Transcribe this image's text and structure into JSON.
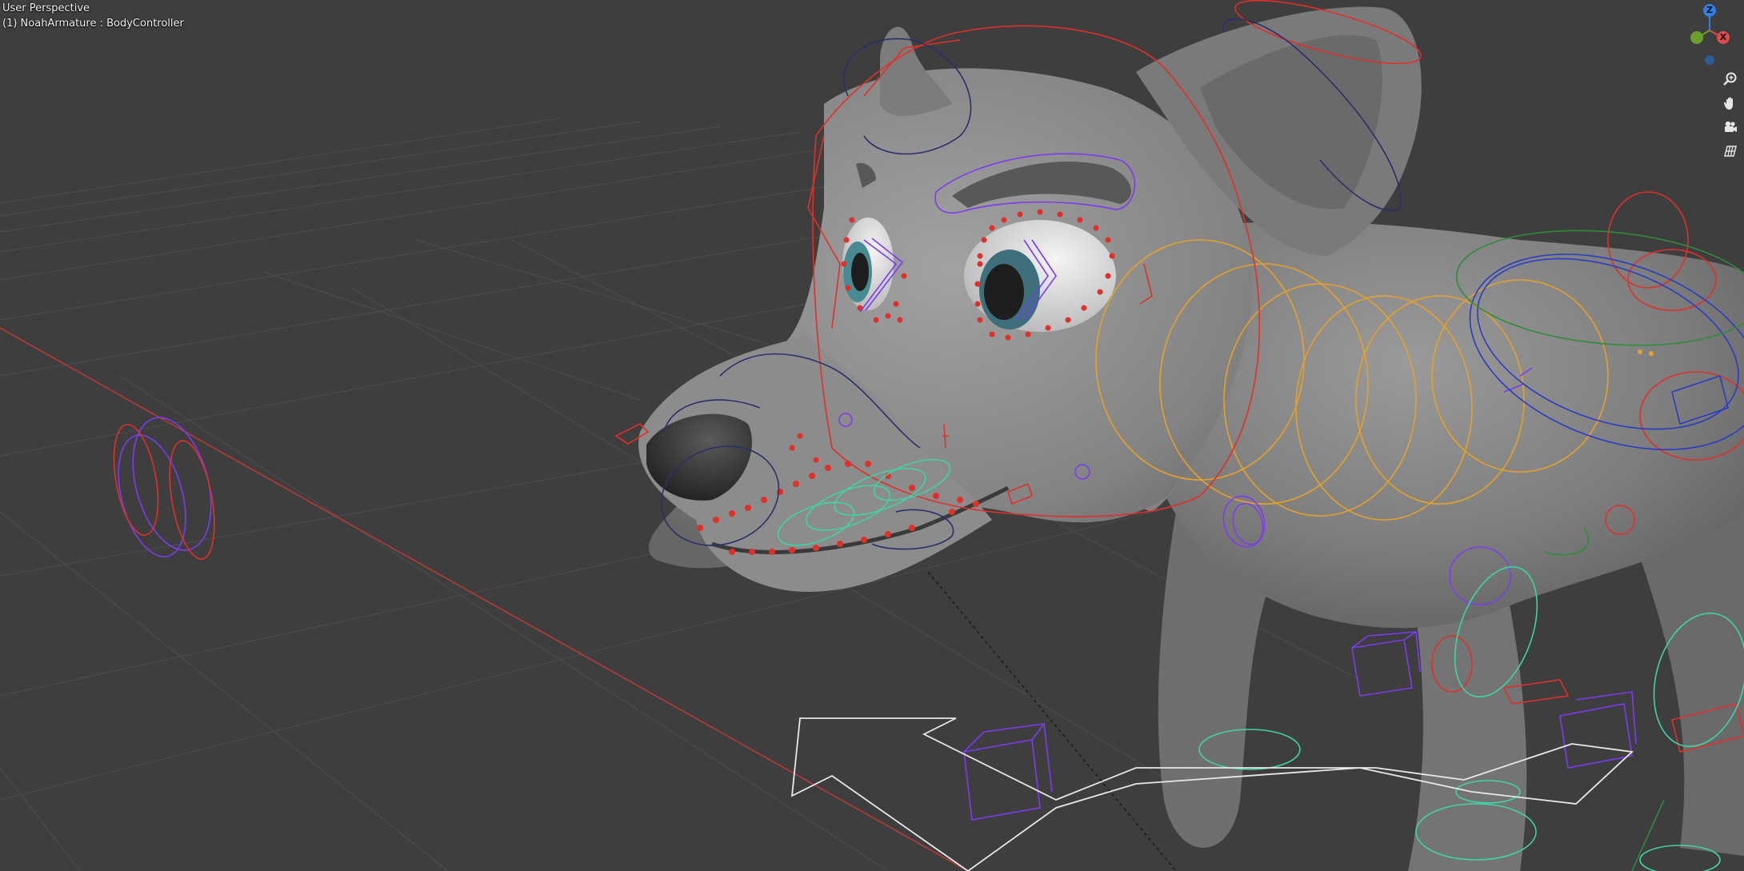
{
  "viewport": {
    "view_name": "User Perspective",
    "active_object": "(1) NoahArmature : BodyController",
    "background_color": "#3e3e3e",
    "grid_color": "#4a4a4a",
    "x_axis_color": "#c03a3a"
  },
  "gizmo": {
    "axes": [
      {
        "label": "Z",
        "color": "#2f7fe8",
        "icon": "z-axis-ball"
      },
      {
        "label": "",
        "color": "#6a9f2c",
        "icon": "y-axis-ball"
      },
      {
        "label": "X",
        "color": "#e04a4a",
        "icon": "x-axis-ball"
      },
      {
        "label": "",
        "color": "#2e5b9a",
        "icon": "neg-z-axis-ball"
      }
    ]
  },
  "navigation_tools": [
    {
      "name": "zoom",
      "icon": "zoom-icon"
    },
    {
      "name": "pan",
      "icon": "hand-icon"
    },
    {
      "name": "camera",
      "icon": "camera-icon"
    },
    {
      "name": "ortho-persp",
      "icon": "grid-icon"
    }
  ],
  "rig_colors": {
    "mesh": "#8a8a8a",
    "red_controls": "#e0302a",
    "purple_controls": "#7b3cf0",
    "blue_controls": "#2b3cc4",
    "orange_controls": "#e6a12a",
    "teal_controls": "#3fd3a8",
    "white_control": "#e8e8e8",
    "navy_controls": "#2a2f6a"
  }
}
